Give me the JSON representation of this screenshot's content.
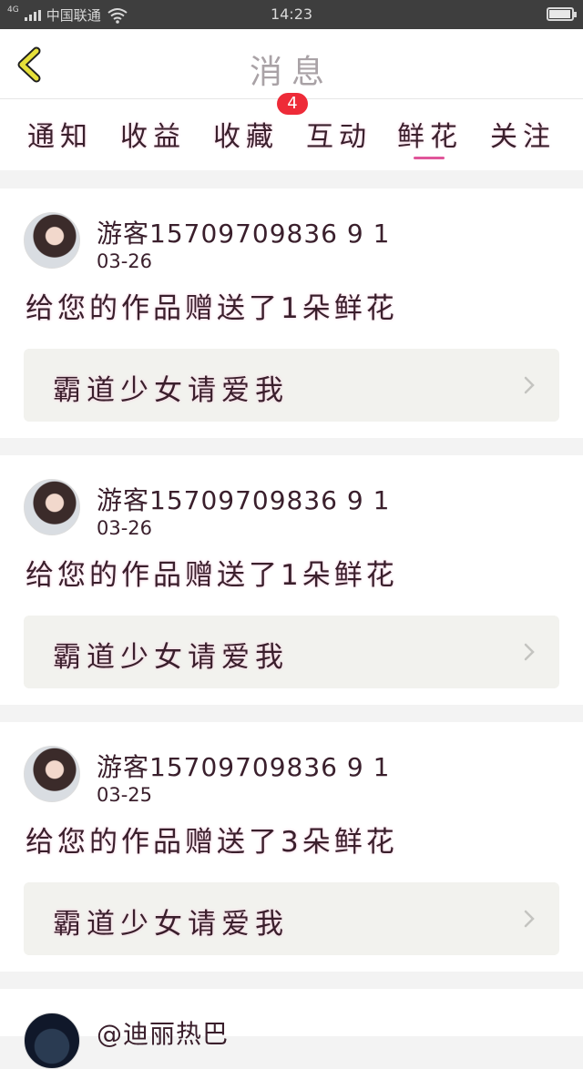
{
  "status_bar": {
    "network": "4G",
    "carrier": "中国联通",
    "time": "14:23",
    "battery_level": 0.95
  },
  "header": {
    "title": "消息"
  },
  "tabs": [
    {
      "label": "通知"
    },
    {
      "label": "收益"
    },
    {
      "label": "收藏",
      "badge": "4"
    },
    {
      "label": "互动"
    },
    {
      "label": "鲜花",
      "selected": true
    },
    {
      "label": "关注"
    }
  ],
  "messages": [
    {
      "user": "游客15709709836 9 1",
      "date": "03-26",
      "text": "给您的作品赠送了1朵鲜花",
      "work_title": "霸道少女请爱我"
    },
    {
      "user": "游客15709709836 9 1",
      "date": "03-26",
      "text": "给您的作品赠送了1朵鲜花",
      "work_title": "霸道少女请爱我"
    },
    {
      "user": "游客15709709836 9 1",
      "date": "03-25",
      "text": "给您的作品赠送了3朵鲜花",
      "work_title": "霸道少女请爱我"
    },
    {
      "user": "@迪丽热巴"
    }
  ],
  "colors": {
    "accent": "#e0559a",
    "badge": "#ee2b38",
    "text": "#3a1f2c",
    "title": "#a9a2a6",
    "back_icon": "#e6e03a"
  },
  "icons": {
    "back": "chevron-left-icon",
    "wifi": "wifi-icon",
    "battery": "battery-icon",
    "signal": "signal-icon",
    "chevron": "chevron-right-icon"
  }
}
